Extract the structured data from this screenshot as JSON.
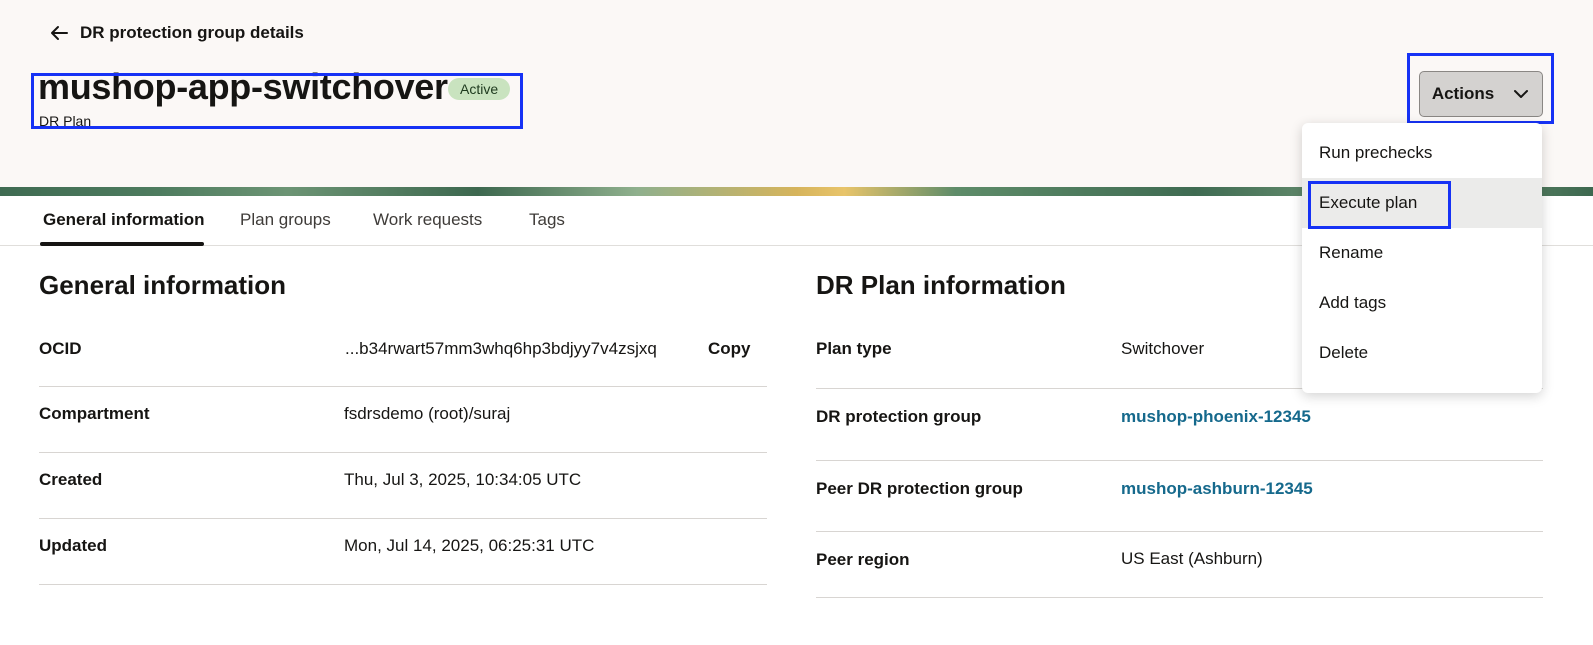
{
  "header": {
    "back_label": "DR protection group details",
    "title": "mushop-app-switchover",
    "status": "Active",
    "subtitle": "DR Plan",
    "actions_label": "Actions"
  },
  "actions_menu": {
    "items": [
      "Run prechecks",
      "Execute plan",
      "Rename",
      "Add tags",
      "Delete"
    ],
    "highlighted": "Execute plan"
  },
  "tabs": {
    "items": [
      "General information",
      "Plan groups",
      "Work requests",
      "Tags"
    ],
    "selected": "General information"
  },
  "general_info": {
    "title": "General information",
    "ocid_label": "OCID",
    "ocid_value": "...b34rwart57mm3whq6hp3bdjyy7v4zsjxq",
    "copy_label": "Copy",
    "compartment_label": "Compartment",
    "compartment_value": "fsdrsdemo (root)/suraj",
    "created_label": "Created",
    "created_value": "Thu, Jul 3, 2025, 10:34:05 UTC",
    "updated_label": "Updated",
    "updated_value": "Mon, Jul 14, 2025, 06:25:31 UTC"
  },
  "plan_info": {
    "title": "DR Plan information",
    "plan_type_label": "Plan type",
    "plan_type_value": "Switchover",
    "pg_label": "DR protection group",
    "pg_value": "mushop-phoenix-12345",
    "peer_pg_label": "Peer DR protection group",
    "peer_pg_value": "mushop-ashburn-12345",
    "peer_region_label": "Peer region",
    "peer_region_value": "US East (Ashburn)"
  },
  "colors": {
    "highlight_box": "#1632f5",
    "link": "#15698c",
    "badge_bg": "#c9e3bf",
    "header_bg": "#fbf8f6"
  }
}
